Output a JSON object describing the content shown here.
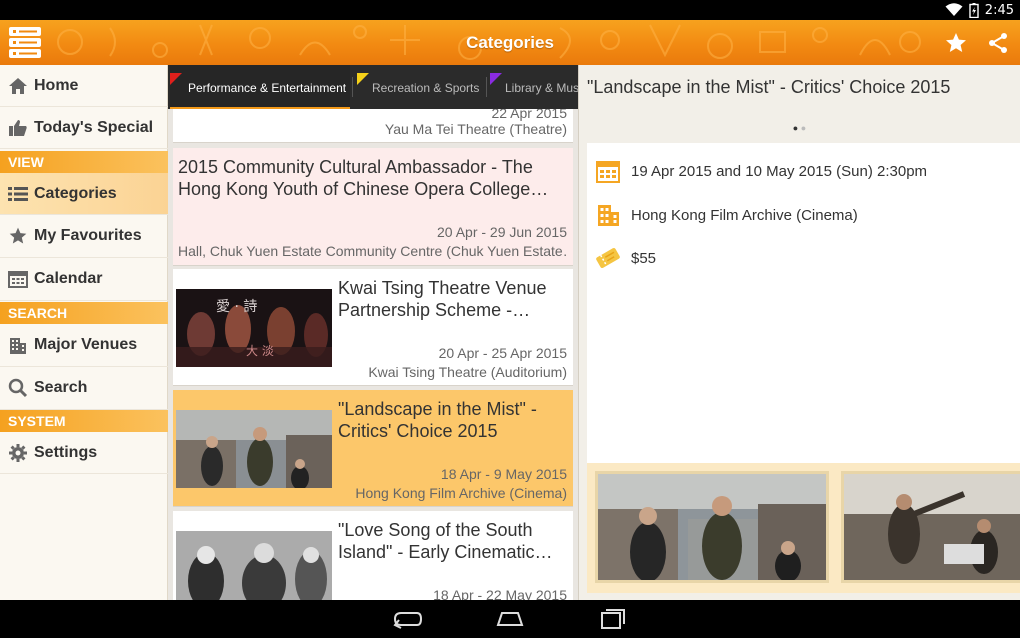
{
  "status_bar": {
    "time": "2:45"
  },
  "action_bar": {
    "title": "Categories"
  },
  "drawer": {
    "home": "Home",
    "todays_special": "Today's Special",
    "view_header": "VIEW",
    "categories": "Categories",
    "my_favourites": "My Favourites",
    "calendar": "Calendar",
    "search_header": "SEARCH",
    "major_venues": "Major Venues",
    "search": "Search",
    "system_header": "SYSTEM",
    "settings": "Settings"
  },
  "tabs": [
    {
      "label": "Performance & Entertainment",
      "color": "#e0201c"
    },
    {
      "label": "Recreation & Sports",
      "color": "#f6d21a"
    },
    {
      "label": "Library & Mus",
      "color": "#8a2be2"
    }
  ],
  "events": [
    {
      "title": "",
      "date": "22 Apr 2015",
      "venue": "Yau Ma Tei Theatre (Theatre)"
    },
    {
      "title": "2015 Community Cultural Ambassador - The Hong Kong Youth of Chinese Opera College…",
      "date": "20 Apr - 29 Jun 2015",
      "venue": "Hall, Chuk Yuen Estate Community Centre (Chuk Yuen Estate…"
    },
    {
      "title": "Kwai Tsing Theatre Venue Partnership Scheme -…",
      "date": "20 Apr - 25 Apr 2015",
      "venue": "Kwai Tsing Theatre (Auditorium)"
    },
    {
      "title": "\"Landscape in the Mist\" - Critics' Choice 2015",
      "date": "18 Apr - 9 May 2015",
      "venue": "Hong Kong Film Archive (Cinema)"
    },
    {
      "title": "\"Love Song of the South Island\" - Early Cinematic…",
      "date": "18 Apr - 22 May 2015",
      "venue": ""
    }
  ],
  "detail": {
    "title": "\"Landscape in the Mist\" - Critics' Choice 2015",
    "datetime": "19 Apr 2015 and 10 May 2015 (Sun) 2:30pm",
    "venue": "Hong Kong Film Archive (Cinema)",
    "price": "$55"
  },
  "colors": {
    "accent": "#f39a1a",
    "selected": "#fcc76a",
    "pink_card": "#fdeceb"
  }
}
